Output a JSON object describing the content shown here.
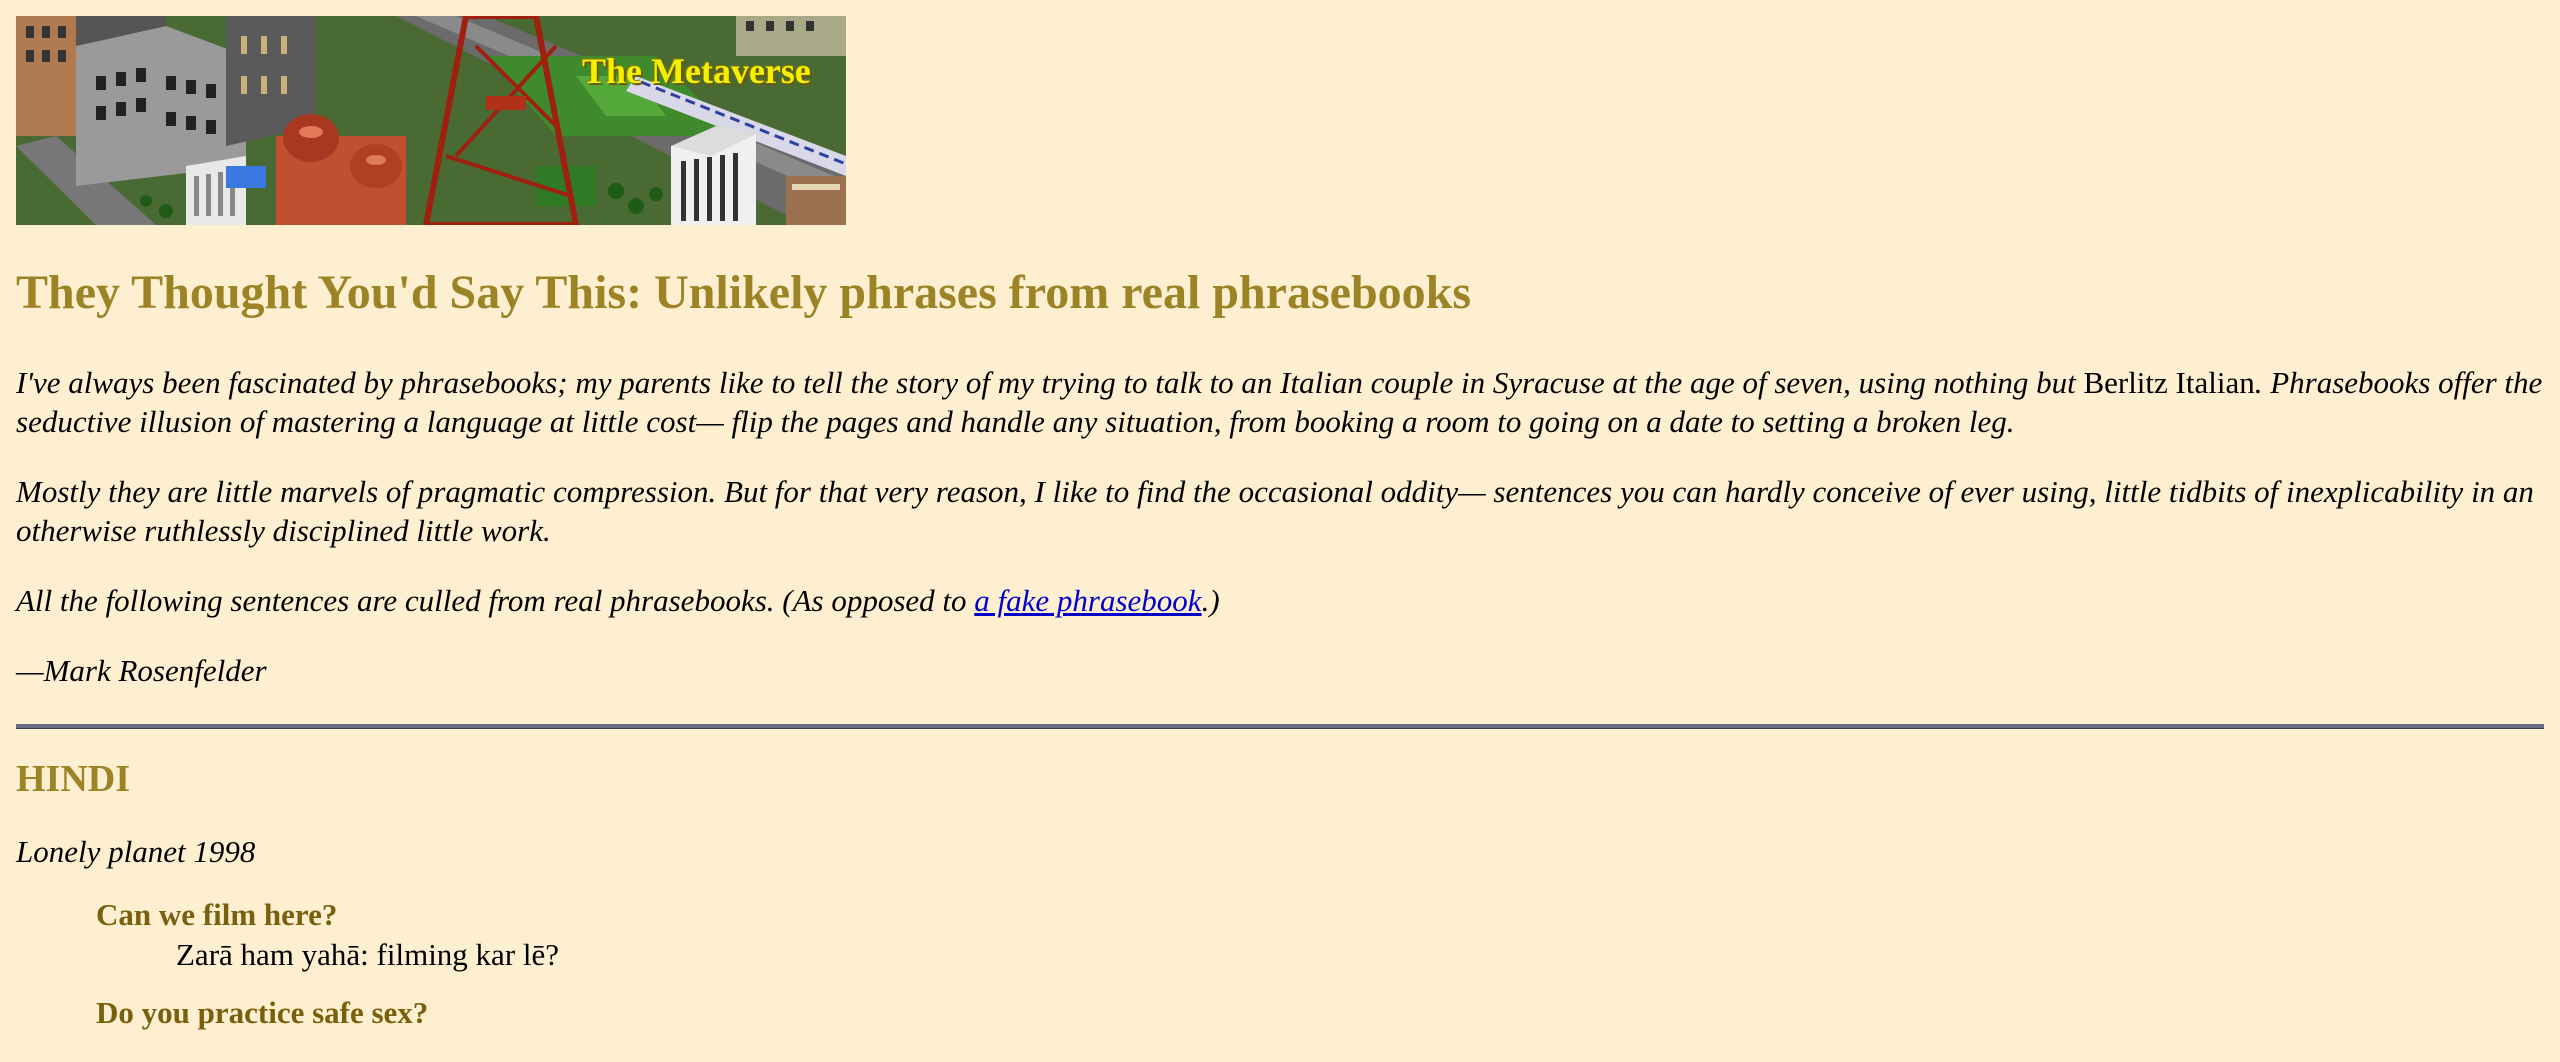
{
  "banner": {
    "text": "The Metaverse"
  },
  "title": "They Thought You'd Say This: Unlikely phrases from real phrasebooks",
  "intro": {
    "p1_before": "I've always been fascinated by phrasebooks; my parents like to tell the story of my trying to talk to an Italian couple in Syracuse at the age of seven, using nothing but",
    "p1_roman": "Berlitz Italian",
    "p1_after": ". Phrasebooks offer the seductive illusion of mastering a language at little cost— flip the pages and handle any situation, from booking a room to going on a date to setting a broken leg.",
    "p2": "Mostly they are little marvels of pragmatic compression. But for that very reason, I like to find the occasional oddity— sentences you can hardly conceive of ever using, little tidbits of inexplicability in an otherwise ruthlessly disciplined little work.",
    "p3_before": "All the following sentences are culled from real phrasebooks. (As opposed to",
    "p3_link": "a fake phrasebook",
    "p3_after": ".)",
    "signature": "—Mark Rosenfelder"
  },
  "section": {
    "heading": "HINDI",
    "source": "Lonely planet 1998",
    "phrases": [
      {
        "en": "Can we film here?",
        "tr": "Zarā ham yahā: filming kar lē?"
      },
      {
        "en": "Do you practice safe sex?",
        "tr": ""
      }
    ]
  },
  "colors": {
    "background": "#fdefcf",
    "heading": "#9c8426",
    "phrase": "#7a5f0c",
    "link": "#0000cc",
    "banner_text": "#f5f000"
  }
}
